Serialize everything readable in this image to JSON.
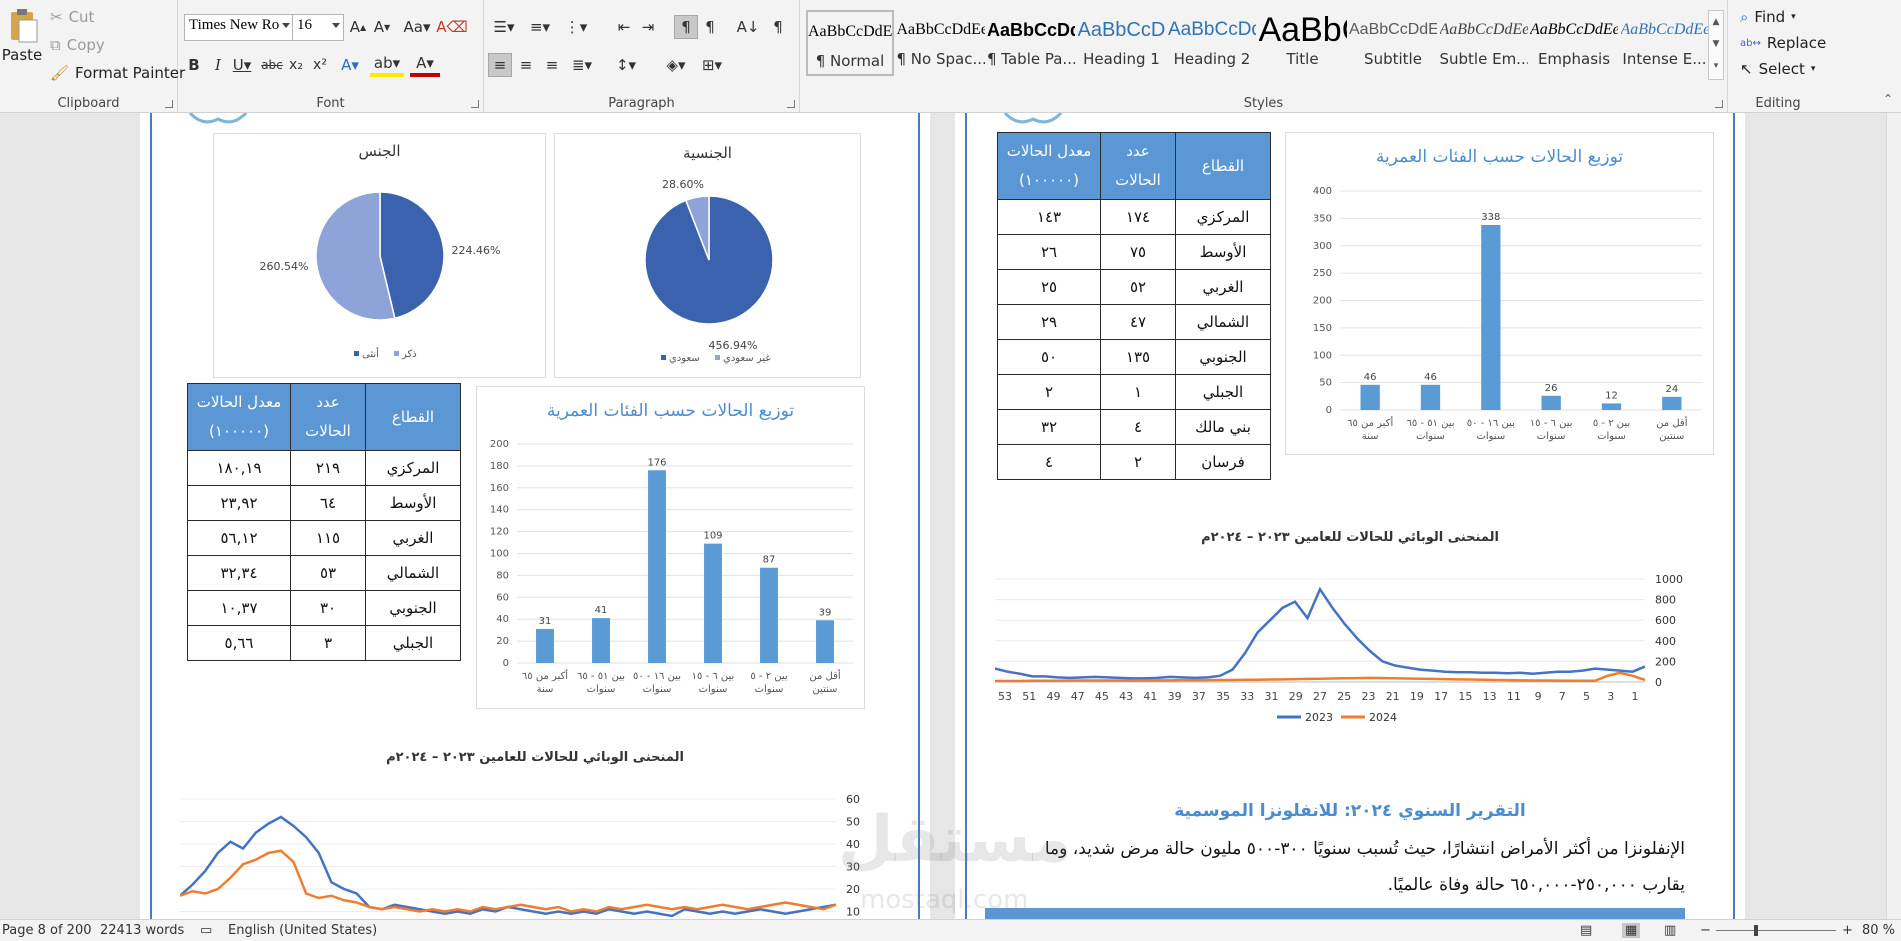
{
  "ribbon": {
    "clipboard": {
      "label": "Clipboard",
      "paste": "Paste",
      "cut": "Cut",
      "copy": "Copy",
      "format_painter": "Format Painter"
    },
    "font": {
      "label": "Font",
      "font_name": "Times New Ro",
      "font_size": "16"
    },
    "paragraph": {
      "label": "Paragraph"
    },
    "styles": {
      "label": "Styles",
      "items": [
        {
          "preview": "AaBbCcDdEe",
          "name": "¶ Normal"
        },
        {
          "preview": "AaBbCcDdEe",
          "name": "¶ No Spac..."
        },
        {
          "preview": "AaBbCcDdEe",
          "name": "¶ Table Pa..."
        },
        {
          "preview": "AaBbCcDdEe",
          "name": "Heading 1"
        },
        {
          "preview": "AaBbCcDdEe",
          "name": "Heading 2"
        },
        {
          "preview": "AaBbCcDdEe",
          "name": "Title"
        },
        {
          "preview": "AaBbCcDdEe",
          "name": "Subtitle"
        },
        {
          "preview": "AaBbCcDdEe",
          "name": "Subtle Em..."
        },
        {
          "preview": "AaBbCcDdEe",
          "name": "Emphasis"
        },
        {
          "preview": "AaBbCcDdEe",
          "name": "Intense E..."
        }
      ]
    },
    "editing": {
      "label": "Editing",
      "find": "Find",
      "replace": "Replace",
      "select": "Select"
    }
  },
  "left_page": {
    "pie_gender": {
      "title": "الجنس",
      "labels": [
        "224.46%",
        "260.54%"
      ],
      "legend": [
        "أنثى",
        "ذكر"
      ]
    },
    "pie_nationality": {
      "title": "الجنسية",
      "labels": [
        "28.60%",
        "456.94%"
      ],
      "legend": [
        "سعودي",
        "غير سعودي"
      ]
    },
    "table": {
      "headers": [
        "القطاع",
        "عدد الحالات",
        "معدل الحالات (١٠٠٠٠٠)"
      ],
      "rows": [
        [
          "المركزي",
          "٢١٩",
          "١٨٠,١٩"
        ],
        [
          "الأوسط",
          "٦٤",
          "٢٣,٩٢"
        ],
        [
          "الغربي",
          "١١٥",
          "٥٦,١٢"
        ],
        [
          "الشمالي",
          "٥٣",
          "٣٢,٣٤"
        ],
        [
          "الجنوبي",
          "٣٠",
          "١٠,٣٧"
        ],
        [
          "الجبلي",
          "٣",
          "٥,٦٦"
        ]
      ]
    },
    "epi_title": "المنحنى الوبائي للحالات للعامين ٢٠٢٣ – ٢٠٢٤م"
  },
  "right_page": {
    "table": {
      "headers": [
        "القطاع",
        "عدد الحالات",
        "معدل الحالات (١٠٠٠٠٠)"
      ],
      "rows": [
        [
          "المركزي",
          "١٧٤",
          "١٤٣"
        ],
        [
          "الأوسط",
          "٧٥",
          "٢٦"
        ],
        [
          "الغربي",
          "٥٢",
          "٢٥"
        ],
        [
          "الشمالي",
          "٤٧",
          "٢٩"
        ],
        [
          "الجنوبي",
          "١٣٥",
          "٥٠"
        ],
        [
          "الجبلي",
          "١",
          "٢"
        ],
        [
          "بني مالك",
          "٤",
          "٣٢"
        ],
        [
          "فرسان",
          "٢",
          "٤"
        ]
      ]
    },
    "epi_title": "المنحنى الوبائي للحالات للعامين ٢٠٢٣ – ٢٠٢٤م",
    "section_heading": "التقرير السنوي ٢٠٢٤: للانفلونزا الموسمية",
    "para_line1": "الإنفلونزا من أكثر الأمراض انتشارًا، حيث تُسبب سنويًا ٣٠٠-٥٠٠ مليون حالة مرض شديد، وما",
    "para_line2": "يقارب ٢٥٠,٠٠٠-٦٥٠,٠٠٠ حالة وفاة عالميًا."
  },
  "chart_data": [
    {
      "type": "pie",
      "title": "الجنس",
      "categories": [
        "أنثى",
        "ذكر"
      ],
      "values": [
        224.46,
        260.54
      ],
      "labels": [
        "224.46%",
        "260.54%"
      ]
    },
    {
      "type": "pie",
      "title": "الجنسية",
      "categories": [
        "سعودي",
        "غير سعودي"
      ],
      "values": [
        456.94,
        28.6
      ],
      "labels": [
        "456.94%",
        "28.60%"
      ]
    },
    {
      "type": "bar",
      "title": "توزيع الحالات حسب الفئات العمرية",
      "categories": [
        "أقل من سنتين",
        "بين ٢ - ٥ سنوات",
        "بين ٦ - ١٥ سنوات",
        "بين ١٦ - ٥٠ سنوات",
        "بين ٥١ - ٦٥ سنوات",
        "أكبر من ٦٥ سنة"
      ],
      "values": [
        39,
        87,
        109,
        176,
        41,
        31
      ],
      "ylim": [
        0,
        200
      ],
      "yticks": [
        0,
        20,
        40,
        60,
        80,
        100,
        120,
        140,
        160,
        180,
        200
      ]
    },
    {
      "type": "bar",
      "title": "توزيع الحالات حسب الفئات العمرية",
      "categories": [
        "أقل من سنتين",
        "بين ٢ - ٥ سنوات",
        "بين ٦ - ١٥ سنوات",
        "بين ١٦ - ٥٠ سنوات",
        "بين ٥١ - ٦٥ سنوات",
        "أكبر من ٦٥ سنة"
      ],
      "values": [
        24,
        12,
        26,
        338,
        46,
        46
      ],
      "ylim": [
        0,
        400
      ],
      "yticks": [
        0,
        50,
        100,
        150,
        200,
        250,
        300,
        350,
        400
      ]
    },
    {
      "type": "line",
      "title": "المنحنى الوبائي للحالات للعامين ٢٠٢٣ – ٢٠٢٤م",
      "ylim": [
        0,
        60
      ],
      "yticks": [
        10,
        20,
        30,
        40,
        50,
        60
      ],
      "series": [
        {
          "name": "2023",
          "color": "#4472c4",
          "values": [
            17,
            22,
            28,
            36,
            41,
            38,
            45,
            49,
            52,
            48,
            43,
            36,
            23,
            20,
            18,
            12,
            11,
            13,
            12,
            11,
            10,
            9,
            10,
            9,
            11,
            10,
            12,
            11,
            10,
            9,
            10,
            9,
            10,
            9,
            11,
            10,
            9,
            10,
            9,
            8,
            11,
            10,
            9,
            10,
            9,
            10,
            11,
            10,
            9,
            10,
            11,
            12,
            13
          ]
        },
        {
          "name": "2024",
          "color": "#ed7d31",
          "values": [
            17,
            19,
            18,
            20,
            25,
            31,
            33,
            36,
            37,
            32,
            18,
            16,
            17,
            15,
            14,
            12,
            11,
            12,
            11,
            10,
            11,
            10,
            11,
            10,
            12,
            11,
            12,
            13,
            12,
            11,
            12,
            10,
            11,
            10,
            12,
            11,
            12,
            13,
            12,
            11,
            12,
            11,
            12,
            13,
            12,
            11,
            12,
            13,
            14,
            13,
            12,
            11,
            13
          ]
        }
      ]
    },
    {
      "type": "line",
      "title": "المنحنى الوبائي للحالات للعامين ٢٠٢٣ – ٢٠٢٤م",
      "ylim": [
        0,
        1000
      ],
      "yticks": [
        0,
        200,
        400,
        600,
        800,
        1000
      ],
      "x": [
        53,
        51,
        49,
        47,
        45,
        43,
        41,
        39,
        37,
        35,
        33,
        31,
        29,
        27,
        25,
        23,
        21,
        19,
        17,
        15,
        13,
        11,
        9,
        7,
        5,
        3,
        1
      ],
      "series": [
        {
          "name": "2023",
          "color": "#4472c4",
          "values": [
            130,
            100,
            80,
            55,
            55,
            45,
            40,
            45,
            50,
            45,
            40,
            35,
            35,
            40,
            50,
            45,
            40,
            45,
            60,
            120,
            280,
            480,
            600,
            720,
            780,
            620,
            900,
            720,
            560,
            420,
            300,
            200,
            160,
            140,
            120,
            110,
            100,
            95,
            95,
            90,
            90,
            85,
            90,
            80,
            90,
            100,
            100,
            110,
            130,
            120,
            110,
            100,
            150
          ]
        },
        {
          "name": "2024",
          "color": "#ed7d31",
          "values": [
            10,
            10,
            10,
            12,
            12,
            12,
            14,
            14,
            14,
            15,
            15,
            15,
            16,
            16,
            16,
            18,
            18,
            18,
            20,
            20,
            22,
            22,
            24,
            26,
            28,
            30,
            32,
            34,
            36,
            38,
            40,
            38,
            36,
            34,
            32,
            30,
            28,
            26,
            24,
            22,
            20,
            18,
            16,
            15,
            14,
            13,
            12,
            12,
            12,
            60,
            90,
            60,
            20
          ]
        }
      ]
    }
  ],
  "status": {
    "page": "Page 8 of 200",
    "words": "22413 words",
    "language": "English (United States)",
    "zoom": "80 %"
  },
  "watermark": {
    "main": "مستقل",
    "sub": "mostaql.com"
  }
}
